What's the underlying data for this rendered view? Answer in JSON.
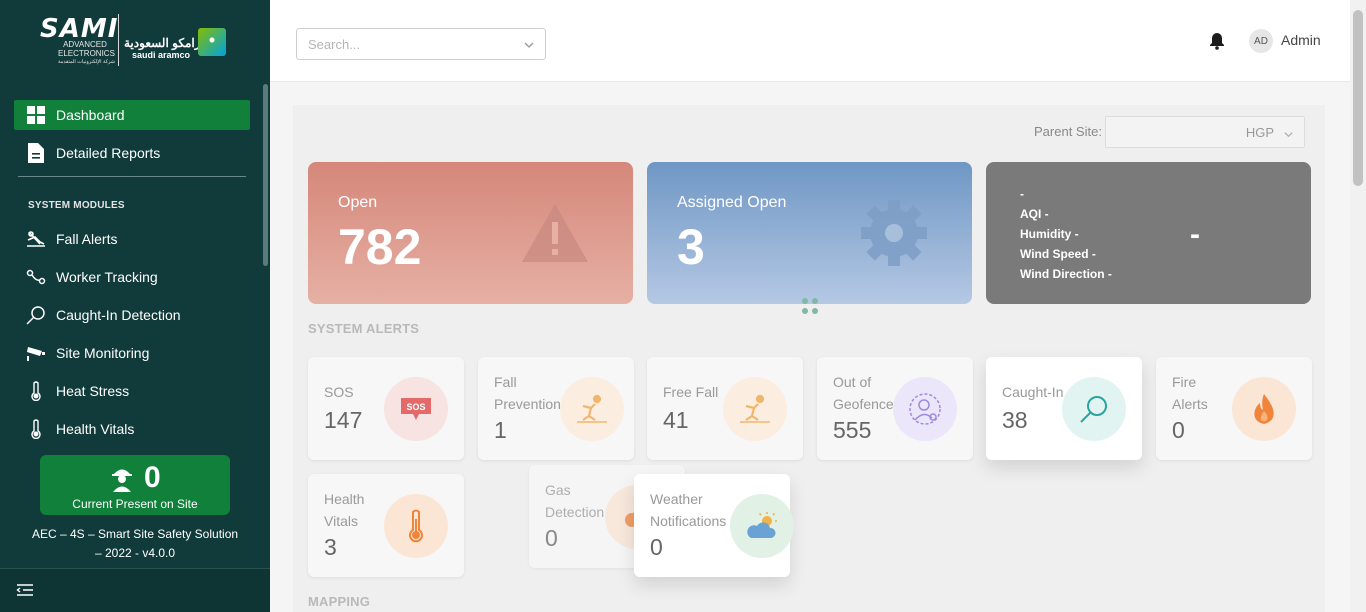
{
  "sidebar": {
    "logo": {
      "brand": "SAMI",
      "brand_sub": "ADVANCED ELECTRONICS",
      "brand_sub_ar": "شركة الإلكترونيات المتقدمة",
      "partner_ar": "أرامكو السعودية",
      "partner_en": "saudi aramco"
    },
    "items": [
      {
        "label": "Dashboard",
        "icon": "grid-icon"
      },
      {
        "label": "Detailed Reports",
        "icon": "document-icon"
      }
    ],
    "section_label": "SYSTEM MODULES",
    "modules": [
      {
        "label": "Fall Alerts",
        "icon": "fall-alert-icon"
      },
      {
        "label": "Worker Tracking",
        "icon": "route-icon"
      },
      {
        "label": "Caught-In Detection",
        "icon": "magnifier-icon"
      },
      {
        "label": "Site Monitoring",
        "icon": "cctv-icon"
      },
      {
        "label": "Heat Stress",
        "icon": "thermometer-icon"
      },
      {
        "label": "Health Vitals",
        "icon": "thermometer-icon"
      }
    ],
    "present": {
      "count": "0",
      "label": "Current Present on Site"
    },
    "version": "AEC – 4S – Smart Site Safety Solution – 2022 - v4.0.0"
  },
  "header": {
    "search_placeholder": "Search...",
    "avatar_initials": "AD",
    "username": "Admin"
  },
  "filters": {
    "parent_site_label": "Parent Site:",
    "parent_site_value": "HGP"
  },
  "summary": {
    "open": {
      "title": "Open",
      "value": "782"
    },
    "assigned": {
      "title": "Assigned Open",
      "value": "3"
    },
    "weather": {
      "line0": "-",
      "aqi": "AQI -",
      "humidity": "Humidity -",
      "wind_speed": "Wind Speed -",
      "wind_direction": "Wind Direction -",
      "value": "-"
    }
  },
  "sections": {
    "system_alerts": "SYSTEM ALERTS",
    "mapping": "MAPPING"
  },
  "alerts": [
    {
      "label": "SOS",
      "value": "147",
      "icon": "sos-icon",
      "color": "#e05a5a"
    },
    {
      "label": "Fall Prevention",
      "value": "1",
      "icon": "falling-person-icon",
      "color": "#f0a85a"
    },
    {
      "label": "Free Fall",
      "value": "41",
      "icon": "falling-person-icon",
      "color": "#f0a85a"
    },
    {
      "label": "Out of Geofence",
      "value": "555",
      "icon": "person-outside-icon",
      "color": "#8c7ae6"
    },
    {
      "label": "Caught-In",
      "value": "38",
      "icon": "magnifier-icon",
      "color": "#29a3a3"
    },
    {
      "label": "Fire Alerts",
      "value": "0",
      "icon": "fire-icon",
      "color": "#f07f2a"
    },
    {
      "label": "Health Vitals",
      "value": "3",
      "icon": "thermometer-icon",
      "color": "#f07f2a"
    },
    {
      "label": "Gas Detection",
      "value": "0",
      "icon": "gas-icon",
      "color": "#f07f2a"
    },
    {
      "label": "Weather Notifications",
      "value": "0",
      "icon": "weather-icon",
      "color": "#5fa8d8"
    }
  ]
}
